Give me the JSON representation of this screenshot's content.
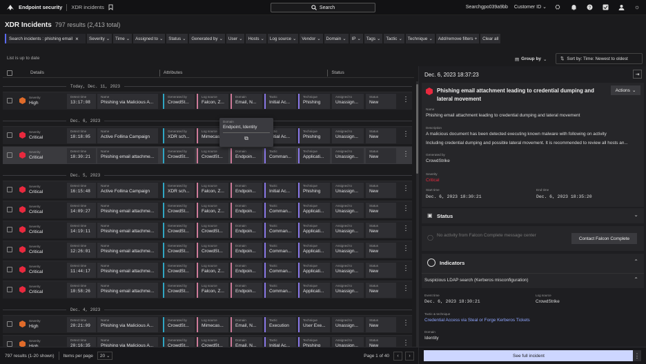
{
  "topbar": {
    "brand": "Endpoint security",
    "crumb": "XDR incidents",
    "search": "Search",
    "user": "Searchgpo039a9bb",
    "customer": "Customer ID"
  },
  "page": {
    "title": "XDR Incidents",
    "count": "797 results (2,413 total)"
  },
  "filters": {
    "query": "Search incidents : phishing email",
    "items": [
      "Severity",
      "Time",
      "Assigned to",
      "Status",
      "Generated by",
      "User",
      "Hosts",
      "Log source",
      "Vendor",
      "Domain",
      "IP",
      "Tags",
      "Tactic",
      "Technique",
      "Add/remove filters"
    ],
    "clear": "Clear all"
  },
  "list": {
    "hint": "List is up to date",
    "group_by": "Group by",
    "sort_by": "Sort by: Time: Newest to oldest"
  },
  "columns": {
    "details": "Details",
    "attributes": "Attributes",
    "status": "Status"
  },
  "labels": {
    "severity": "Severity",
    "detect_time": "Detect time",
    "name": "Name",
    "generated_by": "Generated by",
    "log_source": "Log source",
    "domain": "Domain",
    "tactic": "Tactic",
    "technique": "Technique",
    "assigned_to": "Assigned to",
    "status": "Status"
  },
  "colors": {
    "high": "#e06b2a",
    "critical": "#e8293e",
    "accent": "#5b6bf5",
    "blue_bar": "#2fa6c4",
    "pink_bar": "#cf7b9a",
    "purple_bar": "#8a78e8"
  },
  "groups": [
    {
      "date": "Today, Dec. 11, 2023",
      "rows": [
        {
          "sev": "High",
          "sevc": "high",
          "time": "13:17:08",
          "name": "Phishing via Malicious A...",
          "gen": "CrowdSt...",
          "src": "Falcon, Z...",
          "dom": "Email, N...",
          "tac": "Initial Ac...",
          "tech": "Phishing",
          "asg": "Unassign...",
          "st": "New"
        }
      ]
    },
    {
      "date": "Dec. 6, 2023",
      "rows": [
        {
          "sev": "Critical",
          "sevc": "critical",
          "time": "18:18:05",
          "name": "Active Follina Campaign",
          "gen": "XDR sch...",
          "src": "Mimecas...",
          "dom": "Endpoin...",
          "tac": "Initial Ac...",
          "tech": "Phishing",
          "asg": "Unassign...",
          "st": "New"
        },
        {
          "sev": "Critical",
          "sevc": "critical",
          "time": "18:30:21",
          "name": "Phishing email attachme...",
          "gen": "CrowdSt...",
          "src": "CrowdSt...",
          "dom": "Endpoin...",
          "tac": "Comman...",
          "tech": "Applicati...",
          "asg": "Unassign...",
          "st": "New",
          "sel": true
        }
      ]
    },
    {
      "date": "Dec. 5, 2023",
      "rows": [
        {
          "sev": "Critical",
          "sevc": "critical",
          "time": "16:15:48",
          "name": "Active Follina Campaign",
          "gen": "XDR sch...",
          "src": "Falcon, Z...",
          "dom": "Endpoin...",
          "tac": "Initial Ac...",
          "tech": "Phishing",
          "asg": "Unassign...",
          "st": "New"
        },
        {
          "sev": "Critical",
          "sevc": "critical",
          "time": "14:09:27",
          "name": "Phishing email attachme...",
          "gen": "CrowdSt...",
          "src": "Falcon, Z...",
          "dom": "Endpoin...",
          "tac": "Comman...",
          "tech": "Applicati...",
          "asg": "Unassign...",
          "st": "New"
        },
        {
          "sev": "Critical",
          "sevc": "critical",
          "time": "14:19:11",
          "name": "Phishing email attachme...",
          "gen": "CrowdSt...",
          "src": "CrowdSt...",
          "dom": "Endpoin...",
          "tac": "Comman...",
          "tech": "Applicati...",
          "asg": "Unassign...",
          "st": "New"
        },
        {
          "sev": "Critical",
          "sevc": "critical",
          "time": "12:26:01",
          "name": "Phishing email attachme...",
          "gen": "CrowdSt...",
          "src": "CrowdSt...",
          "dom": "Endpoin...",
          "tac": "Comman...",
          "tech": "Applicati...",
          "asg": "Unassign...",
          "st": "New"
        },
        {
          "sev": "Critical",
          "sevc": "critical",
          "time": "11:44:17",
          "name": "Phishing email attachme...",
          "gen": "CrowdSt...",
          "src": "Falcon, Z...",
          "dom": "Endpoin...",
          "tac": "Comman...",
          "tech": "Applicati...",
          "asg": "Unassign...",
          "st": "New"
        },
        {
          "sev": "Critical",
          "sevc": "critical",
          "time": "10:58:26",
          "name": "Phishing email attachme...",
          "gen": "CrowdSt...",
          "src": "Falcon, Z...",
          "dom": "Endpoin...",
          "tac": "Comman...",
          "tech": "Applicati...",
          "asg": "Unassign...",
          "st": "New"
        }
      ]
    },
    {
      "date": "Dec. 4, 2023",
      "rows": [
        {
          "sev": "High",
          "sevc": "high",
          "time": "20:21:09",
          "name": "Phishing via Malicious A...",
          "gen": "CrowdSt...",
          "src": "Mimecas...",
          "dom": "Email, N...",
          "tac": "Execution",
          "tech": "User Exe...",
          "asg": "Unassign...",
          "st": "New"
        },
        {
          "sev": "High",
          "sevc": "high",
          "time": "20:16:35",
          "name": "Phishing via Malicious A...",
          "gen": "CrowdSt...",
          "src": "CrowdSt...",
          "dom": "Email, N...",
          "tac": "Initial Ac...",
          "tech": "Phishing",
          "asg": "Unassign...",
          "st": "New"
        }
      ]
    }
  ],
  "tooltip": {
    "label": "Domain",
    "value": "Endpoint, Identity"
  },
  "footer": {
    "results": "797 results (1-20 shown)",
    "items_per_page": "Items per page",
    "per_page_value": "20",
    "page": "Page 1 of 40"
  },
  "panel": {
    "timestamp": "Dec. 6, 2023 18:37:23",
    "title_l1": "Phishing email attachment leading to credential dumping and",
    "title_l2": "lateral movement",
    "actions": "Actions",
    "name_label": "Name",
    "name": "Phishing email attachment leading to credential dumping and lateral movement",
    "desc_label": "Description",
    "desc_l1": "A malicious document has been detected executing known malware with following on activity",
    "desc_l2": "Including credential dumping and possible lateral movement. It is recommended to review all hosts an...",
    "gen_label": "Generated by",
    "gen": "CrowdStrike",
    "sev_label": "Severity",
    "sev": "Critical",
    "start_label": "Start time",
    "start": "Dec. 6, 2023 18:30:21",
    "end_label": "End time",
    "end": "Dec. 6, 2023 18:35:20",
    "status_h": "Status",
    "no_activity": "No activity from Falcon Complete message center",
    "contact": "Contact Falcon Complete",
    "indicators_h": "Indicators",
    "ind_title": "Suspicious LDAP search (Kerberos misconfiguration)",
    "ev_label": "Event time",
    "ev": "Dec. 6, 2023 18:30:21",
    "ls_label": "Log source",
    "ls": "CrowdStrike",
    "tt_label": "Tactic & technique",
    "tt": "Credential Access via Steal or Forge Kerberos Tickets",
    "dom_label": "Domain",
    "dom": "Identity",
    "see_full": "See full incident"
  }
}
